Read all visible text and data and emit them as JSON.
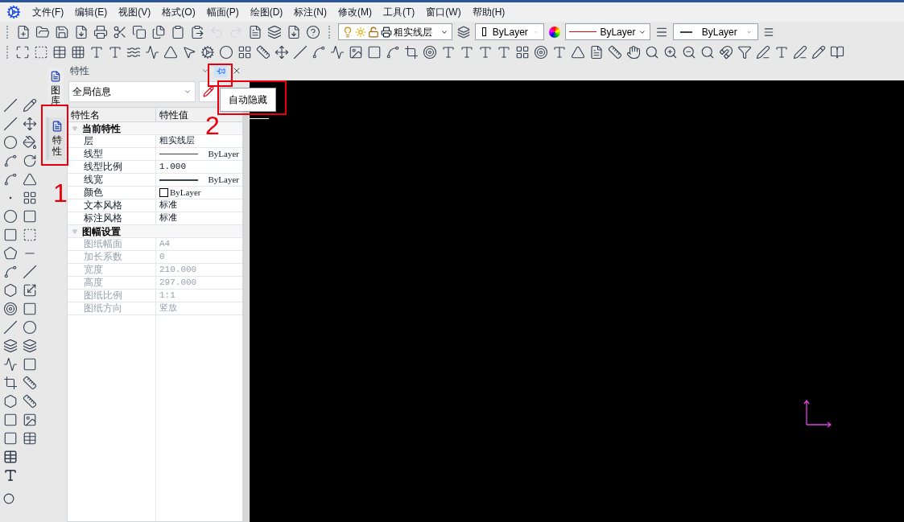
{
  "menu": [
    "文件(F)",
    "编辑(E)",
    "视图(V)",
    "格式(O)",
    "幅面(P)",
    "绘图(D)",
    "标注(N)",
    "修改(M)",
    "工具(T)",
    "窗口(W)",
    "帮助(H)"
  ],
  "toolbar": {
    "layer": "粗实线层",
    "color_setting": "ByLayer",
    "linetype": "ByLayer",
    "lineweight": "ByLayer"
  },
  "side_tabs": [
    {
      "label": "图库",
      "selected": false
    },
    {
      "label": "特性",
      "selected": true
    }
  ],
  "panel": {
    "title": "特性",
    "filter": "全局信息",
    "tooltip": "自动隐藏",
    "columns": [
      "特性名",
      "特性值"
    ],
    "sections": [
      {
        "title": "当前特性",
        "expanded": true,
        "rows": [
          {
            "name": "层",
            "value": "粗实线层",
            "kind": "text",
            "disabled": false
          },
          {
            "name": "线型",
            "value": "ByLayer",
            "kind": "line",
            "disabled": false
          },
          {
            "name": "线型比例",
            "value": "1.000",
            "kind": "text",
            "disabled": false
          },
          {
            "name": "线宽",
            "value": "ByLayer",
            "kind": "lineweight",
            "disabled": false
          },
          {
            "name": "颜色",
            "value": "ByLayer",
            "kind": "color",
            "disabled": false
          },
          {
            "name": "文本风格",
            "value": "标准",
            "kind": "text",
            "disabled": false
          },
          {
            "name": "标注风格",
            "value": "标准",
            "kind": "text",
            "disabled": false
          }
        ]
      },
      {
        "title": "图幅设置",
        "expanded": true,
        "rows": [
          {
            "name": "图纸幅面",
            "value": "A4",
            "kind": "text",
            "disabled": true
          },
          {
            "name": "加长系数",
            "value": "0",
            "kind": "text",
            "disabled": true
          },
          {
            "name": "宽度",
            "value": "210.000",
            "kind": "text",
            "disabled": true
          },
          {
            "name": "高度",
            "value": "297.000",
            "kind": "text",
            "disabled": true
          },
          {
            "name": "图纸比例",
            "value": "1:1",
            "kind": "text",
            "disabled": true
          },
          {
            "name": "图纸方向",
            "value": "竖放",
            "kind": "text",
            "disabled": true
          }
        ]
      }
    ]
  },
  "annotations": [
    "1",
    "2"
  ]
}
